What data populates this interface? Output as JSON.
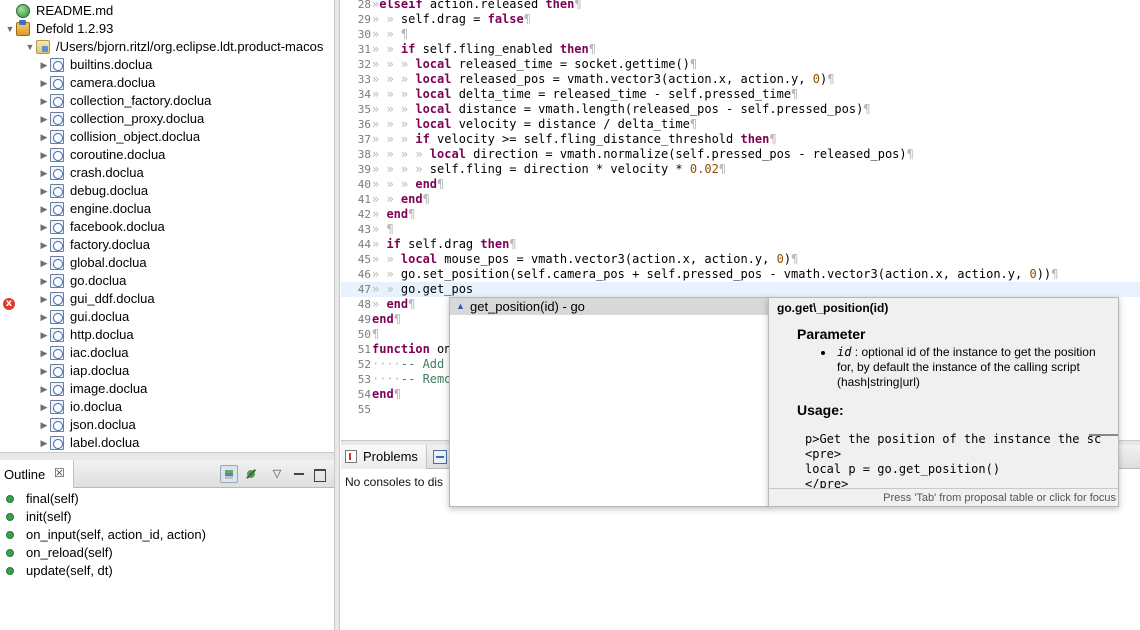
{
  "explorer": {
    "items": [
      {
        "label": "README.md",
        "icon": "globe-icon",
        "twisty": ""
      },
      {
        "label": "Defold 1.2.93",
        "icon": "project-icon",
        "twisty": "▼"
      },
      {
        "label": "/Users/bjorn.ritzl/org.eclipse.ldt.product-macos",
        "icon": "folder-icon",
        "twisty": "▼"
      },
      {
        "label": "builtins.doclua",
        "icon": "doclua-icon",
        "twisty": "▶"
      },
      {
        "label": "camera.doclua",
        "icon": "doclua-icon",
        "twisty": "▶"
      },
      {
        "label": "collection_factory.doclua",
        "icon": "doclua-icon",
        "twisty": "▶"
      },
      {
        "label": "collection_proxy.doclua",
        "icon": "doclua-icon",
        "twisty": "▶"
      },
      {
        "label": "collision_object.doclua",
        "icon": "doclua-icon",
        "twisty": "▶"
      },
      {
        "label": "coroutine.doclua",
        "icon": "doclua-icon",
        "twisty": "▶"
      },
      {
        "label": "crash.doclua",
        "icon": "doclua-icon",
        "twisty": "▶"
      },
      {
        "label": "debug.doclua",
        "icon": "doclua-icon",
        "twisty": "▶"
      },
      {
        "label": "engine.doclua",
        "icon": "doclua-icon",
        "twisty": "▶"
      },
      {
        "label": "facebook.doclua",
        "icon": "doclua-icon",
        "twisty": "▶"
      },
      {
        "label": "factory.doclua",
        "icon": "doclua-icon",
        "twisty": "▶"
      },
      {
        "label": "global.doclua",
        "icon": "doclua-icon",
        "twisty": "▶"
      },
      {
        "label": "go.doclua",
        "icon": "doclua-icon",
        "twisty": "▶"
      },
      {
        "label": "gui_ddf.doclua",
        "icon": "doclua-icon",
        "twisty": "▶"
      },
      {
        "label": "gui.doclua",
        "icon": "doclua-icon",
        "twisty": "▶"
      },
      {
        "label": "http.doclua",
        "icon": "doclua-icon",
        "twisty": "▶"
      },
      {
        "label": "iac.doclua",
        "icon": "doclua-icon",
        "twisty": "▶"
      },
      {
        "label": "iap.doclua",
        "icon": "doclua-icon",
        "twisty": "▶"
      },
      {
        "label": "image.doclua",
        "icon": "doclua-icon",
        "twisty": "▶"
      },
      {
        "label": "io.doclua",
        "icon": "doclua-icon",
        "twisty": "▶"
      },
      {
        "label": "json.doclua",
        "icon": "doclua-icon",
        "twisty": "▶"
      },
      {
        "label": "label.doclua",
        "icon": "doclua-icon",
        "twisty": "▶"
      }
    ]
  },
  "outline": {
    "title": "Outline",
    "close": "☒",
    "menu_glyph": "▽",
    "items": [
      "final(self)",
      "init(self)",
      "on_input(self, action_id, action)",
      "on_reload(self)",
      "update(self, dt)"
    ]
  },
  "editor": {
    "current_line": "47",
    "error_line": "48",
    "lines": [
      {
        "n": "28",
        "segs": [
          [
            "ws",
            "»"
          ],
          [
            "kw",
            "elseif"
          ],
          [
            "t",
            " action.released "
          ],
          [
            "kw",
            "then"
          ],
          [
            "ws",
            "¶"
          ]
        ]
      },
      {
        "n": "29",
        "segs": [
          [
            "ws",
            "» » "
          ],
          [
            "t",
            "self.drag = "
          ],
          [
            "kw",
            "false"
          ],
          [
            "ws",
            "¶"
          ]
        ]
      },
      {
        "n": "30",
        "segs": [
          [
            "ws",
            "» » ¶"
          ]
        ]
      },
      {
        "n": "31",
        "segs": [
          [
            "ws",
            "» » "
          ],
          [
            "kw",
            "if"
          ],
          [
            "t",
            " self.fling_enabled "
          ],
          [
            "kw",
            "then"
          ],
          [
            "ws",
            "¶"
          ]
        ]
      },
      {
        "n": "32",
        "segs": [
          [
            "ws",
            "» » » "
          ],
          [
            "kw",
            "local"
          ],
          [
            "t",
            " released_time = socket.gettime()"
          ],
          [
            "ws",
            "¶"
          ]
        ]
      },
      {
        "n": "33",
        "segs": [
          [
            "ws",
            "» » » "
          ],
          [
            "kw",
            "local"
          ],
          [
            "t",
            " released_pos = vmath.vector3(action.x, action.y, "
          ],
          [
            "num",
            "0"
          ],
          [
            "t",
            ")"
          ],
          [
            "ws",
            "¶"
          ]
        ]
      },
      {
        "n": "34",
        "segs": [
          [
            "ws",
            "» » » "
          ],
          [
            "kw",
            "local"
          ],
          [
            "t",
            " delta_time = released_time - self.pressed_time"
          ],
          [
            "ws",
            "¶"
          ]
        ]
      },
      {
        "n": "35",
        "segs": [
          [
            "ws",
            "» » » "
          ],
          [
            "kw",
            "local"
          ],
          [
            "t",
            " distance = vmath.length(released_pos - self.pressed_pos)"
          ],
          [
            "ws",
            "¶"
          ]
        ]
      },
      {
        "n": "36",
        "segs": [
          [
            "ws",
            "» » » "
          ],
          [
            "kw",
            "local"
          ],
          [
            "t",
            " velocity = distance / delta_time"
          ],
          [
            "ws",
            "¶"
          ]
        ]
      },
      {
        "n": "37",
        "segs": [
          [
            "ws",
            "» » » "
          ],
          [
            "kw",
            "if"
          ],
          [
            "t",
            " velocity >= self.fling_distance_threshold "
          ],
          [
            "kw",
            "then"
          ],
          [
            "ws",
            "¶"
          ]
        ]
      },
      {
        "n": "38",
        "segs": [
          [
            "ws",
            "» » » » "
          ],
          [
            "kw",
            "local"
          ],
          [
            "t",
            " direction = vmath.normalize(self.pressed_pos - released_pos)"
          ],
          [
            "ws",
            "¶"
          ]
        ]
      },
      {
        "n": "39",
        "segs": [
          [
            "ws",
            "» » » » "
          ],
          [
            "t",
            "self.fling = direction * velocity * "
          ],
          [
            "num",
            "0.02"
          ],
          [
            "ws",
            "¶"
          ]
        ]
      },
      {
        "n": "40",
        "segs": [
          [
            "ws",
            "» » » "
          ],
          [
            "kw",
            "end"
          ],
          [
            "ws",
            "¶"
          ]
        ]
      },
      {
        "n": "41",
        "segs": [
          [
            "ws",
            "» » "
          ],
          [
            "kw",
            "end"
          ],
          [
            "ws",
            "¶"
          ]
        ]
      },
      {
        "n": "42",
        "segs": [
          [
            "ws",
            "» "
          ],
          [
            "kw",
            "end"
          ],
          [
            "ws",
            "¶"
          ]
        ]
      },
      {
        "n": "43",
        "segs": [
          [
            "ws",
            "» ¶"
          ]
        ]
      },
      {
        "n": "44",
        "segs": [
          [
            "ws",
            "» "
          ],
          [
            "kw",
            "if"
          ],
          [
            "t",
            " self.drag "
          ],
          [
            "kw",
            "then"
          ],
          [
            "ws",
            "¶"
          ]
        ]
      },
      {
        "n": "45",
        "segs": [
          [
            "ws",
            "» » "
          ],
          [
            "kw",
            "local"
          ],
          [
            "t",
            " mouse_pos = vmath.vector3(action.x, action.y, "
          ],
          [
            "num",
            "0"
          ],
          [
            "t",
            ")"
          ],
          [
            "ws",
            "¶"
          ]
        ]
      },
      {
        "n": "46",
        "segs": [
          [
            "ws",
            "» » "
          ],
          [
            "t",
            "go.set_position(self.camera_pos + self.pressed_pos - vmath.vector3(action.x, action.y, "
          ],
          [
            "num",
            "0"
          ],
          [
            "t",
            "))"
          ],
          [
            "ws",
            "¶"
          ]
        ]
      },
      {
        "n": "47",
        "segs": [
          [
            "ws",
            "» » "
          ],
          [
            "t",
            "go.get_pos"
          ]
        ]
      },
      {
        "n": "48",
        "segs": [
          [
            "ws",
            "» "
          ],
          [
            "kw",
            "end"
          ],
          [
            "ws",
            "¶"
          ]
        ]
      },
      {
        "n": "49",
        "segs": [
          [
            "kw",
            "end"
          ],
          [
            "ws",
            "¶"
          ]
        ]
      },
      {
        "n": "50",
        "segs": [
          [
            "ws",
            "¶"
          ]
        ]
      },
      {
        "n": "51",
        "segs": [
          [
            "kw",
            "function"
          ],
          [
            "t",
            " on"
          ]
        ]
      },
      {
        "n": "52",
        "segs": [
          [
            "ws",
            "····"
          ],
          [
            "cmt",
            "-- Add"
          ]
        ]
      },
      {
        "n": "53",
        "segs": [
          [
            "ws",
            "····"
          ],
          [
            "cmt",
            "-- Remo"
          ]
        ]
      },
      {
        "n": "54",
        "segs": [
          [
            "kw",
            "end"
          ],
          [
            "ws",
            "¶"
          ]
        ]
      },
      {
        "n": "55",
        "segs": []
      }
    ]
  },
  "bottom": {
    "problems_label": "Problems",
    "console_message": "No consoles to dis"
  },
  "assist": {
    "proposal_label": "get_position(id) - go",
    "proposal_icon": "▲"
  },
  "doc": {
    "title": "go.get\\_position(id)",
    "param_heading": "Parameter",
    "param_name": "id",
    "param_text": " : optional id of the instance to get the position for, by default the instance of the calling script (hash|string|url)",
    "usage_heading": "Usage:",
    "code_lines": [
      "p>Get the position of the instance the sc",
      "<pre>",
      "local p = go.get_position()",
      "</pre>"
    ],
    "footer": "Press 'Tab' from proposal table or click for focus"
  }
}
